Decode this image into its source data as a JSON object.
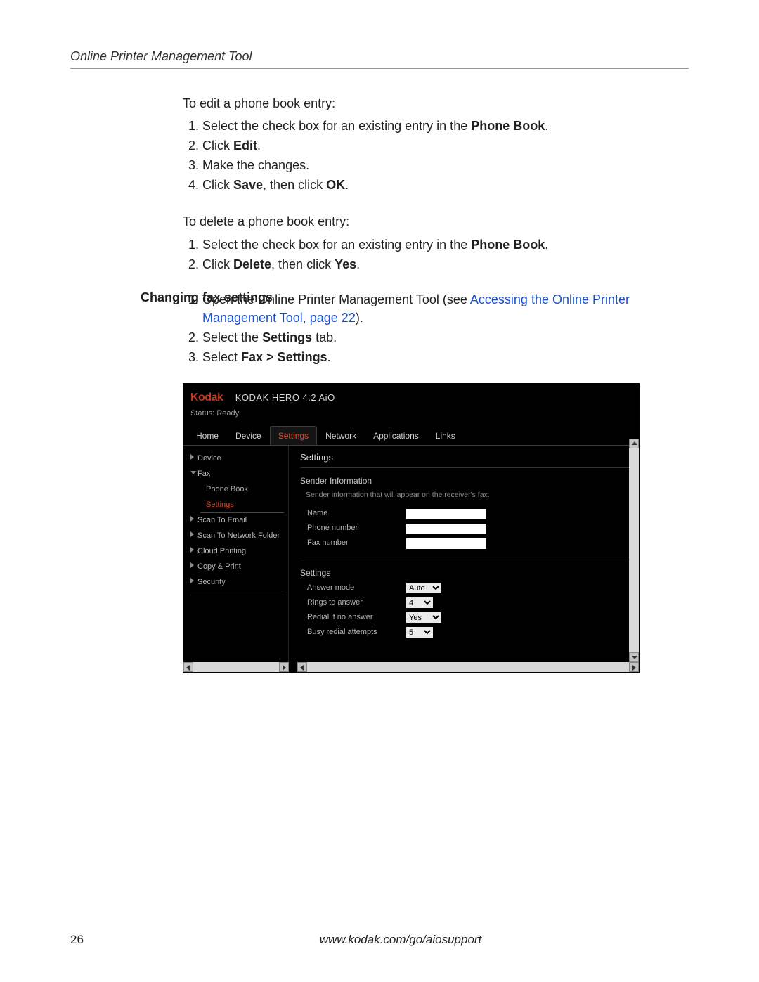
{
  "header": {
    "title": "Online Printer Management Tool"
  },
  "edit_section": {
    "intro": "To edit a phone book entry:",
    "step1_pre": "Select the check box for an existing entry in the ",
    "step1_bold": "Phone Book",
    "step1_post": ".",
    "step2_pre": "Click ",
    "step2_bold": "Edit",
    "step2_post": ".",
    "step3": "Make the changes.",
    "step4_pre": "Click ",
    "step4_bold1": "Save",
    "step4_mid": ", then click ",
    "step4_bold2": "OK",
    "step4_post": "."
  },
  "delete_section": {
    "intro": "To delete a phone book entry:",
    "step1_pre": "Select the check box for an existing entry in the ",
    "step1_bold": "Phone Book",
    "step1_post": ".",
    "step2_pre": "Click ",
    "step2_bold1": "Delete",
    "step2_mid": ", then click ",
    "step2_bold2": "Yes",
    "step2_post": "."
  },
  "fax_section": {
    "heading": "Changing fax settings",
    "step1_pre": "Open the Online Printer Management Tool (see ",
    "step1_link": "Accessing the Online Printer Management Tool, page 22",
    "step1_post": ").",
    "step2_pre": "Select the ",
    "step2_bold": "Settings",
    "step2_post": " tab.",
    "step3_pre": "Select ",
    "step3_bold": "Fax > Settings",
    "step3_post": "."
  },
  "app": {
    "logo": "Kodak",
    "model": "KODAK HERO 4.2 AiO",
    "status": "Status: Ready",
    "tabs": {
      "home": "Home",
      "device": "Device",
      "settings": "Settings",
      "network": "Network",
      "applications": "Applications",
      "links": "Links"
    },
    "sidebar": {
      "device": "Device",
      "fax": "Fax",
      "phone_book": "Phone Book",
      "settings": "Settings",
      "scan_email": "Scan To Email",
      "scan_network": "Scan To Network Folder",
      "cloud_printing": "Cloud Printing",
      "copy_print": "Copy & Print",
      "security": "Security"
    },
    "content": {
      "title": "Settings",
      "sender_title": "Sender Information",
      "sender_sub": "Sender information that will appear on the receiver's fax.",
      "name_label": "Name",
      "phone_label": "Phone number",
      "fax_label": "Fax number",
      "settings_title": "Settings",
      "answer_mode_label": "Answer mode",
      "answer_mode_value": "Auto",
      "rings_label": "Rings to answer",
      "rings_value": "4",
      "redial_label": "Redial if no answer",
      "redial_value": "Yes",
      "busy_label": "Busy redial attempts",
      "busy_value": "5",
      "name_value": "",
      "phone_value": "",
      "fax_value": ""
    }
  },
  "footer": {
    "page": "26",
    "url": "www.kodak.com/go/aiosupport"
  }
}
